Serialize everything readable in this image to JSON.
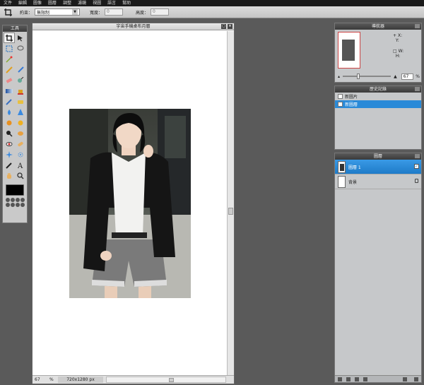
{
  "menu": [
    "文件",
    "編輯",
    "圖像",
    "圖層",
    "調整",
    "濾鏡",
    "視圖",
    "語言",
    "幫助"
  ],
  "options": {
    "constraint_label": "約束：",
    "constraint_value": "無限制",
    "width_label": "寬度：",
    "width_value": "0",
    "height_label": "高度：",
    "height_value": "0"
  },
  "tools_panel": {
    "title": "工具",
    "icons": [
      "crop-icon",
      "move-icon",
      "marquee-icon",
      "lasso-icon",
      "wand-icon",
      "",
      "pencil-icon",
      "brush-icon",
      "eraser-icon",
      "clone-icon",
      "gradient-icon",
      "bucket-icon",
      "picker-icon",
      "smudge-icon",
      "drop-icon",
      "sharpen-icon",
      "dodge-icon",
      "burn-icon",
      "zoom-icon",
      "sponge-icon",
      "redeye-icon",
      "spot-heal-icon",
      "bloat-icon",
      "pinch-icon",
      "color-replace-icon",
      "text-icon",
      "hand-icon",
      "magnify-icon"
    ],
    "foreground_color": "#000000"
  },
  "document": {
    "title": "宇宙手機桌布月曆",
    "zoom": "67",
    "zoom_unit": "%",
    "size": "720x1280 px"
  },
  "navigator": {
    "title": "導航器",
    "x_label": "X:",
    "y_label": "Y:",
    "w_label": "W:",
    "h_label": "H:",
    "zoom_value": "67",
    "zoom_unit": "%",
    "zoom_level": 0.3
  },
  "history": {
    "title": "歷史記錄",
    "items": [
      {
        "label": "新圖片",
        "selected": false
      },
      {
        "label": "新圖層",
        "selected": true
      }
    ]
  },
  "layers": {
    "title": "圖層",
    "items": [
      {
        "label": "圖層 1",
        "selected": true,
        "visible_check": "✓"
      },
      {
        "label": "背景",
        "selected": false
      }
    ]
  },
  "colors": {
    "accent": "#2a8ad8",
    "menubar": "#1a1a1a",
    "workspace": "#5a5a5a"
  }
}
